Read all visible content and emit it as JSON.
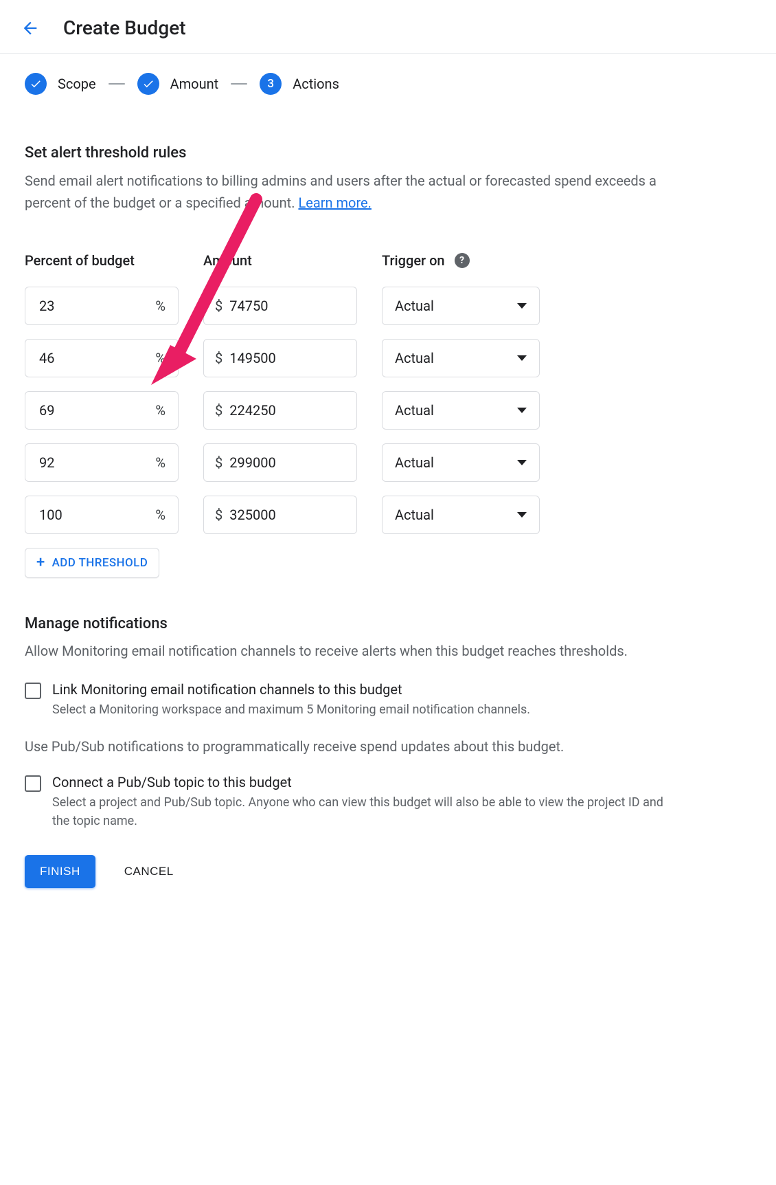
{
  "header": {
    "title": "Create Budget"
  },
  "stepper": {
    "steps": [
      {
        "label": "Scope",
        "state": "done"
      },
      {
        "label": "Amount",
        "state": "done"
      },
      {
        "label": "Actions",
        "state": "current",
        "number": "3"
      }
    ]
  },
  "alert_section": {
    "title": "Set alert threshold rules",
    "description": "Send email alert notifications to billing admins and users after the actual or forecasted spend exceeds a percent of the budget or a specified amount. ",
    "learn_more": "Learn more."
  },
  "threshold_table": {
    "headers": {
      "percent": "Percent of budget",
      "amount": "Amount",
      "trigger": "Trigger on"
    },
    "currency_prefix": "$",
    "percent_suffix": "%",
    "rows": [
      {
        "percent": "23",
        "amount": "74750",
        "trigger": "Actual"
      },
      {
        "percent": "46",
        "amount": "149500",
        "trigger": "Actual"
      },
      {
        "percent": "69",
        "amount": "224250",
        "trigger": "Actual"
      },
      {
        "percent": "92",
        "amount": "299000",
        "trigger": "Actual"
      },
      {
        "percent": "100",
        "amount": "325000",
        "trigger": "Actual"
      }
    ],
    "add_button": "ADD THRESHOLD"
  },
  "manage_section": {
    "title": "Manage notifications",
    "description": "Allow Monitoring email notification channels to receive alerts when this budget reaches thresholds.",
    "link_monitoring": {
      "label": "Link Monitoring email notification channels to this budget",
      "sub": "Select a Monitoring workspace and maximum 5 Monitoring email notification channels."
    },
    "pubsub_desc": "Use Pub/Sub notifications to programmatically receive spend updates about this budget.",
    "connect_pubsub": {
      "label": "Connect a Pub/Sub topic to this budget",
      "sub": "Select a project and Pub/Sub topic. Anyone who can view this budget will also be able to view the project ID and the topic name."
    }
  },
  "actions": {
    "finish": "FINISH",
    "cancel": "CANCEL"
  }
}
